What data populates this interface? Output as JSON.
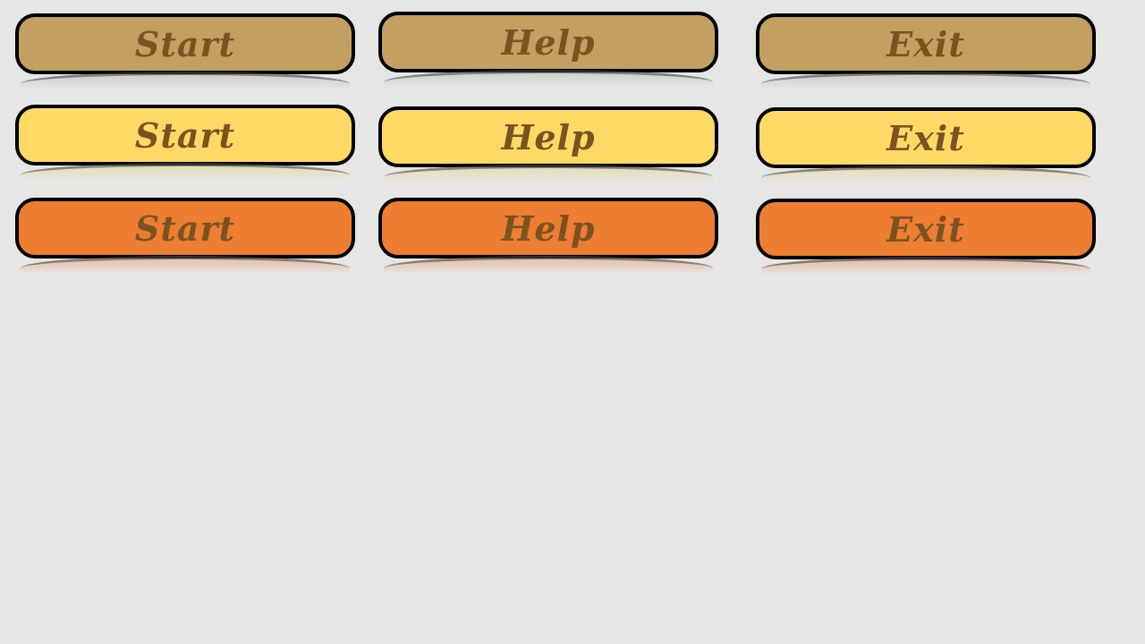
{
  "button_rows": [
    {
      "theme": "tan",
      "color": "#c1a061",
      "buttons": [
        {
          "label": "Start"
        },
        {
          "label": "Help"
        },
        {
          "label": "Exit"
        }
      ]
    },
    {
      "theme": "yellow",
      "color": "#fed966",
      "buttons": [
        {
          "label": "Start"
        },
        {
          "label": "Help"
        },
        {
          "label": "Exit"
        }
      ]
    },
    {
      "theme": "orange",
      "color": "#ed7d31",
      "buttons": [
        {
          "label": "Start"
        },
        {
          "label": "Help"
        },
        {
          "label": "Exit"
        }
      ]
    }
  ],
  "label_color": "#7b5321",
  "background_color": "#e6e6e4"
}
